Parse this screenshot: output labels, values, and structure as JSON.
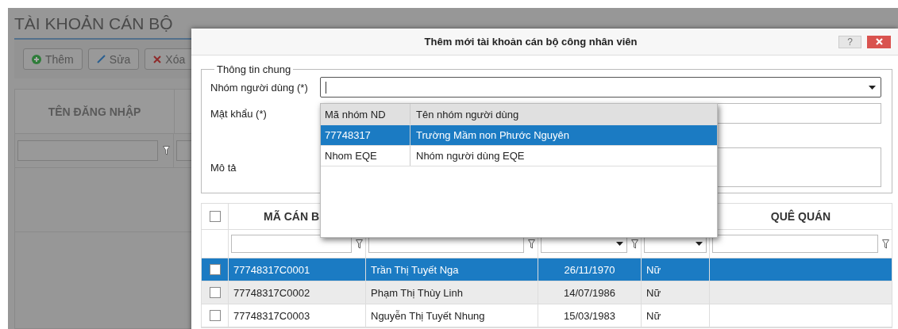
{
  "page": {
    "title": "TÀI KHOẢN CÁN BỘ",
    "buttons": [
      {
        "kind": "add",
        "label": "Thêm"
      },
      {
        "kind": "edit",
        "label": "Sửa"
      },
      {
        "kind": "delete",
        "label": "Xóa"
      }
    ],
    "grid": {
      "column_1": "TÊN ĐĂNG NHẬP"
    }
  },
  "dialog": {
    "title": "Thêm mới tài khoản cán bộ công nhân viên",
    "help_button": "?",
    "form": {
      "legend": "Thông tin chung",
      "fields": [
        {
          "kind": "combo",
          "label": "Nhóm người dùng (*)",
          "focused": true
        },
        {
          "kind": "password",
          "label": "Mật khẩu (*)",
          "focused": false
        },
        {
          "kind": "textarea",
          "label": "Mô tả",
          "focused": false
        }
      ]
    },
    "dropdown": {
      "columns": [
        "Mã nhóm ND",
        "Tên nhóm người dùng"
      ],
      "rows": [
        {
          "selected": true,
          "cells": [
            "77748317",
            "Trường Mầm non Phước Nguyên"
          ]
        },
        {
          "selected": false,
          "cells": [
            "Nhom EQE",
            "Nhóm người dùng EQE"
          ]
        }
      ]
    },
    "grid": {
      "header_checkbox": {
        "checked": false
      },
      "columns": [
        {
          "label": "MÃ CÁN B",
          "kind": "text"
        },
        {
          "kind": "text"
        },
        {
          "kind": "date"
        },
        {
          "kind": "select"
        },
        {
          "label": "QUÊ QUÁN",
          "kind": "text"
        }
      ],
      "rows": [
        {
          "selected": true,
          "checked": false,
          "cells": [
            "77748317C0001",
            "Trần Thị Tuyết Nga",
            "26/11/1970",
            "Nữ"
          ]
        },
        {
          "selected": false,
          "checked": false,
          "cells": [
            "77748317C0002",
            "Phạm Thị Thùy Linh",
            "14/07/1986",
            "Nữ"
          ]
        },
        {
          "selected": false,
          "checked": false,
          "cells": [
            "77748317C0003",
            "Nguyễn Thị Tuyết Nhung",
            "15/03/1983",
            "Nữ"
          ]
        }
      ]
    }
  }
}
